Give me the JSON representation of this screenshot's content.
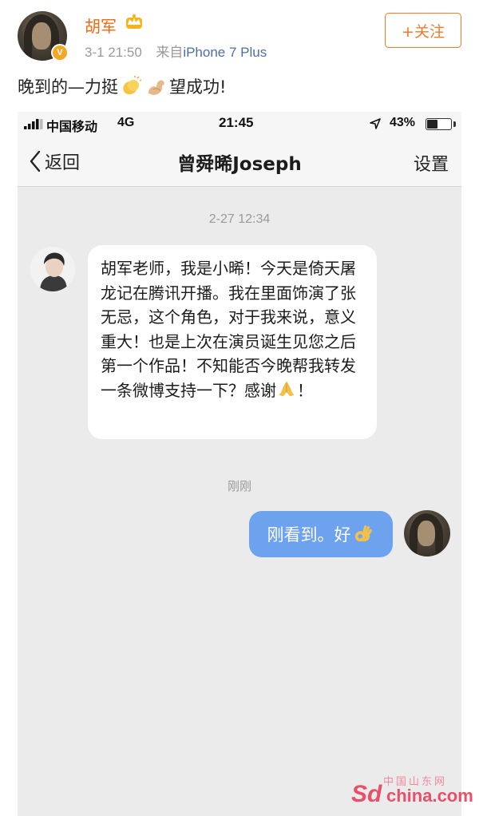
{
  "post": {
    "author_name": "胡军",
    "time": "3-1 21:50",
    "source_prefix": "来自",
    "source_device": "iPhone 7 Plus",
    "follow_label": "+关注",
    "text_part1": "晚到的—力挺",
    "text_part2": "望成功!",
    "verified_mark": "V"
  },
  "status_bar": {
    "carrier": "中国移动",
    "network": "4G",
    "time": "21:45",
    "battery": "43%",
    "battery_level": 0.43
  },
  "nav": {
    "back_label": "返回",
    "title": "曾舜晞Joseph",
    "settings_label": "设置"
  },
  "messages": {
    "timestamp_1": "2-27 12:34",
    "incoming_text": "胡军老师，我是小晞！今天是倚天屠龙记在腾讯开播。我在里面饰演了张无忌，这个角色，对于我来说，意义重大！也是上次在演员诞生见您之后第一个作品！不知能否今晚帮我转发一条微博支持一下？感谢",
    "incoming_suffix": "！",
    "timestamp_2": "刚刚",
    "outgoing_text": "刚看到。好"
  },
  "watermark": {
    "small": "中国山东网",
    "logo": "Sd",
    "domain": "china.com"
  },
  "icons": [
    "crown-icon",
    "clapping-hands-icon",
    "flexed-biceps-icon",
    "signal-icon",
    "location-arrow-icon",
    "battery-icon",
    "back-chevron-icon",
    "folded-hands-icon",
    "ok-hand-icon"
  ],
  "colors": {
    "author_orange": "#f26a0f",
    "link_blue": "#4b6fa6",
    "outgoing_bubble": "#6da2ef",
    "chat_background": "#ebebeb"
  }
}
